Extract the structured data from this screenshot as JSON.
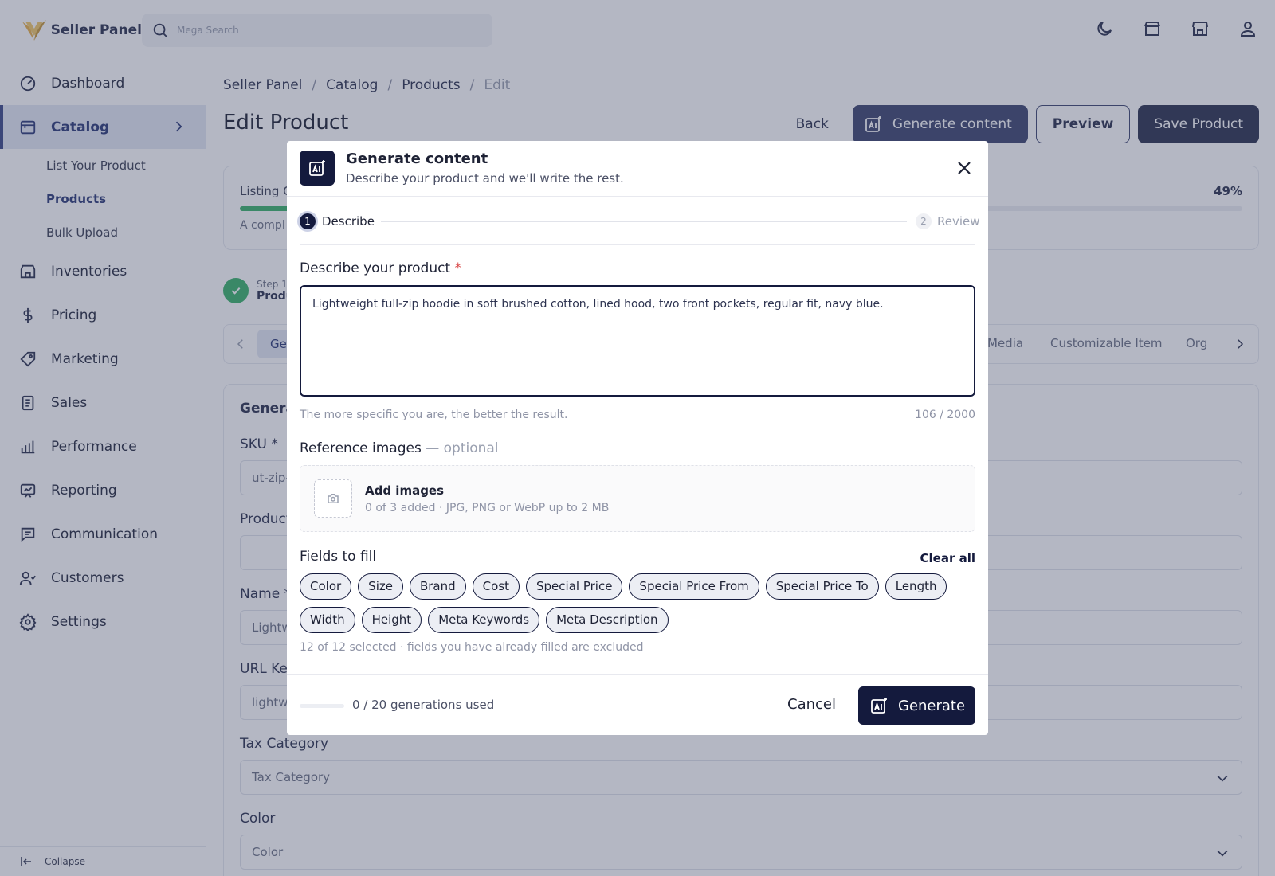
{
  "app": {
    "name": "Seller Panel"
  },
  "search": {
    "placeholder": "Mega Search"
  },
  "top_icons": [
    "moon-icon",
    "store-icon",
    "shop-icon",
    "user-icon"
  ],
  "sidebar": {
    "items": [
      {
        "label": "Dashboard",
        "icon": "dashboard-icon"
      },
      {
        "label": "Catalog",
        "icon": "catalog-icon",
        "active": true
      },
      {
        "label": "Inventories",
        "icon": "inventory-icon"
      },
      {
        "label": "Pricing",
        "icon": "dollar-icon"
      },
      {
        "label": "Marketing",
        "icon": "tag-icon"
      },
      {
        "label": "Sales",
        "icon": "sales-icon"
      },
      {
        "label": "Performance",
        "icon": "chart-icon"
      },
      {
        "label": "Reporting",
        "icon": "report-icon"
      },
      {
        "label": "Communication",
        "icon": "chat-icon"
      },
      {
        "label": "Customers",
        "icon": "customers-icon"
      },
      {
        "label": "Settings",
        "icon": "gear-icon"
      }
    ],
    "sub_items": [
      "List Your Product",
      "Products",
      "Bulk Upload"
    ],
    "collapse_label": "Collapse"
  },
  "breadcrumb": [
    "Seller Panel",
    "Catalog",
    "Products",
    "Edit"
  ],
  "page": {
    "title": "Edit Product",
    "back": "Back",
    "generate": "Generate content",
    "preview": "Preview",
    "save": "Save Product"
  },
  "listing": {
    "label": "Listing C",
    "percent": "49%",
    "progress": 0.49,
    "hint": "A compl"
  },
  "stepper": {
    "step": "Step 1",
    "name": "Produ"
  },
  "tabs": {
    "first": "Ge",
    "media": "Media",
    "custom": "Customizable Item",
    "org": "Org"
  },
  "form": {
    "section_title": "Genera",
    "sku_label": "SKU *",
    "sku_value": "ut-zip-",
    "product_label": "Product",
    "name_label": "Name *",
    "name_value": "Lightw",
    "url_label": "URL Key",
    "url_value": "lightwe",
    "tax_label": "Tax Category",
    "tax_placeholder": "Tax Category",
    "color_label": "Color",
    "color_placeholder": "Color"
  },
  "modal": {
    "title": "Generate content",
    "subtitle": "Describe your product and we'll write the rest.",
    "steps": [
      {
        "num": "1",
        "label": "Describe"
      },
      {
        "num": "2",
        "label": "Review"
      }
    ],
    "describe_label": "Describe your product",
    "required_mark": "*",
    "description": "Lightweight full-zip hoodie in soft brushed cotton, lined hood, two front pockets, regular fit, navy blue.",
    "hint": "The more specific you are, the better the result.",
    "char_count": "106 / 2000",
    "ref_label": "Reference images",
    "ref_optional": "— optional",
    "add_images": "Add images",
    "add_images_sub": "0 of 3 added · JPG, PNG or WebP up to 2 MB",
    "fields_label": "Fields to fill",
    "clear_all": "Clear all",
    "fields": [
      "Color",
      "Size",
      "Brand",
      "Cost",
      "Special Price",
      "Special Price From",
      "Special Price To",
      "Length",
      "Width",
      "Height",
      "Meta Keywords",
      "Meta Description"
    ],
    "fields_note": "12 of 12 selected · fields you have already filled are excluded",
    "usage": "0 / 20 generations used",
    "usage_progress": 0,
    "cancel": "Cancel",
    "generate": "Generate"
  },
  "colors": {
    "accent": "#141a3d",
    "success": "#3ab36b",
    "overlay": "#3a4262"
  }
}
